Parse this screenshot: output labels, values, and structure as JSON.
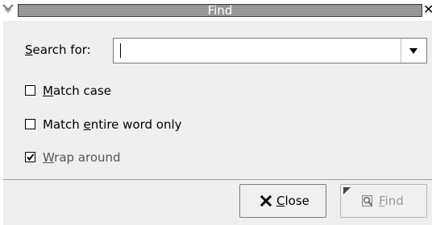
{
  "window": {
    "title": "Find",
    "menu_icon": "window-menu-icon",
    "close_glyph": "✕"
  },
  "search": {
    "label_mnemonic": "S",
    "label_rest": "earch for:",
    "value": "",
    "dropdown_icon": "chevron-down-icon"
  },
  "options": {
    "match_case": {
      "mnemonic": "M",
      "rest": "atch case",
      "checked": false
    },
    "entire_word": {
      "before": "Match ",
      "mnemonic": "e",
      "after": "ntire word only",
      "checked": false
    },
    "wrap_around": {
      "mnemonic": "W",
      "rest": "rap around",
      "checked": true
    }
  },
  "buttons": {
    "close": {
      "icon": "close-icon",
      "mnemonic": "C",
      "rest": "lose"
    },
    "find": {
      "icon": "find-icon",
      "mnemonic": "F",
      "rest": "ind",
      "enabled": false
    }
  }
}
